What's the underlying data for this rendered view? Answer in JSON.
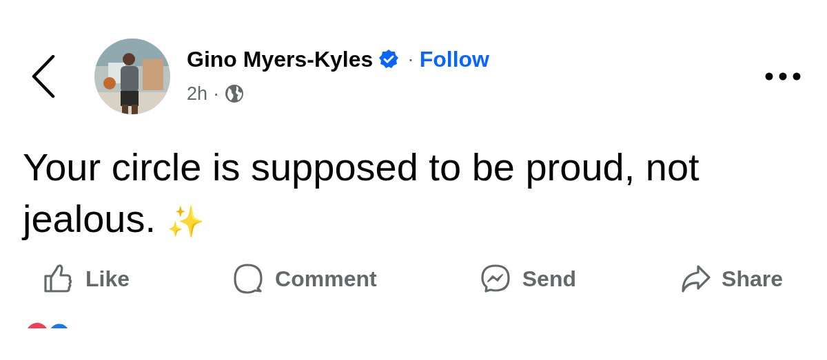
{
  "author": {
    "name": "Gino Myers-Kyles",
    "verified": true,
    "follow": "Follow",
    "separator": "·",
    "time": "2h",
    "time_separator": "·"
  },
  "post": {
    "text": "Your circle is supposed to be proud, not jealous.",
    "emoji": "✨"
  },
  "actions": [
    {
      "kind": "like",
      "label": "Like"
    },
    {
      "kind": "comment",
      "label": "Comment"
    },
    {
      "kind": "send",
      "label": "Send"
    },
    {
      "kind": "share",
      "label": "Share"
    }
  ]
}
